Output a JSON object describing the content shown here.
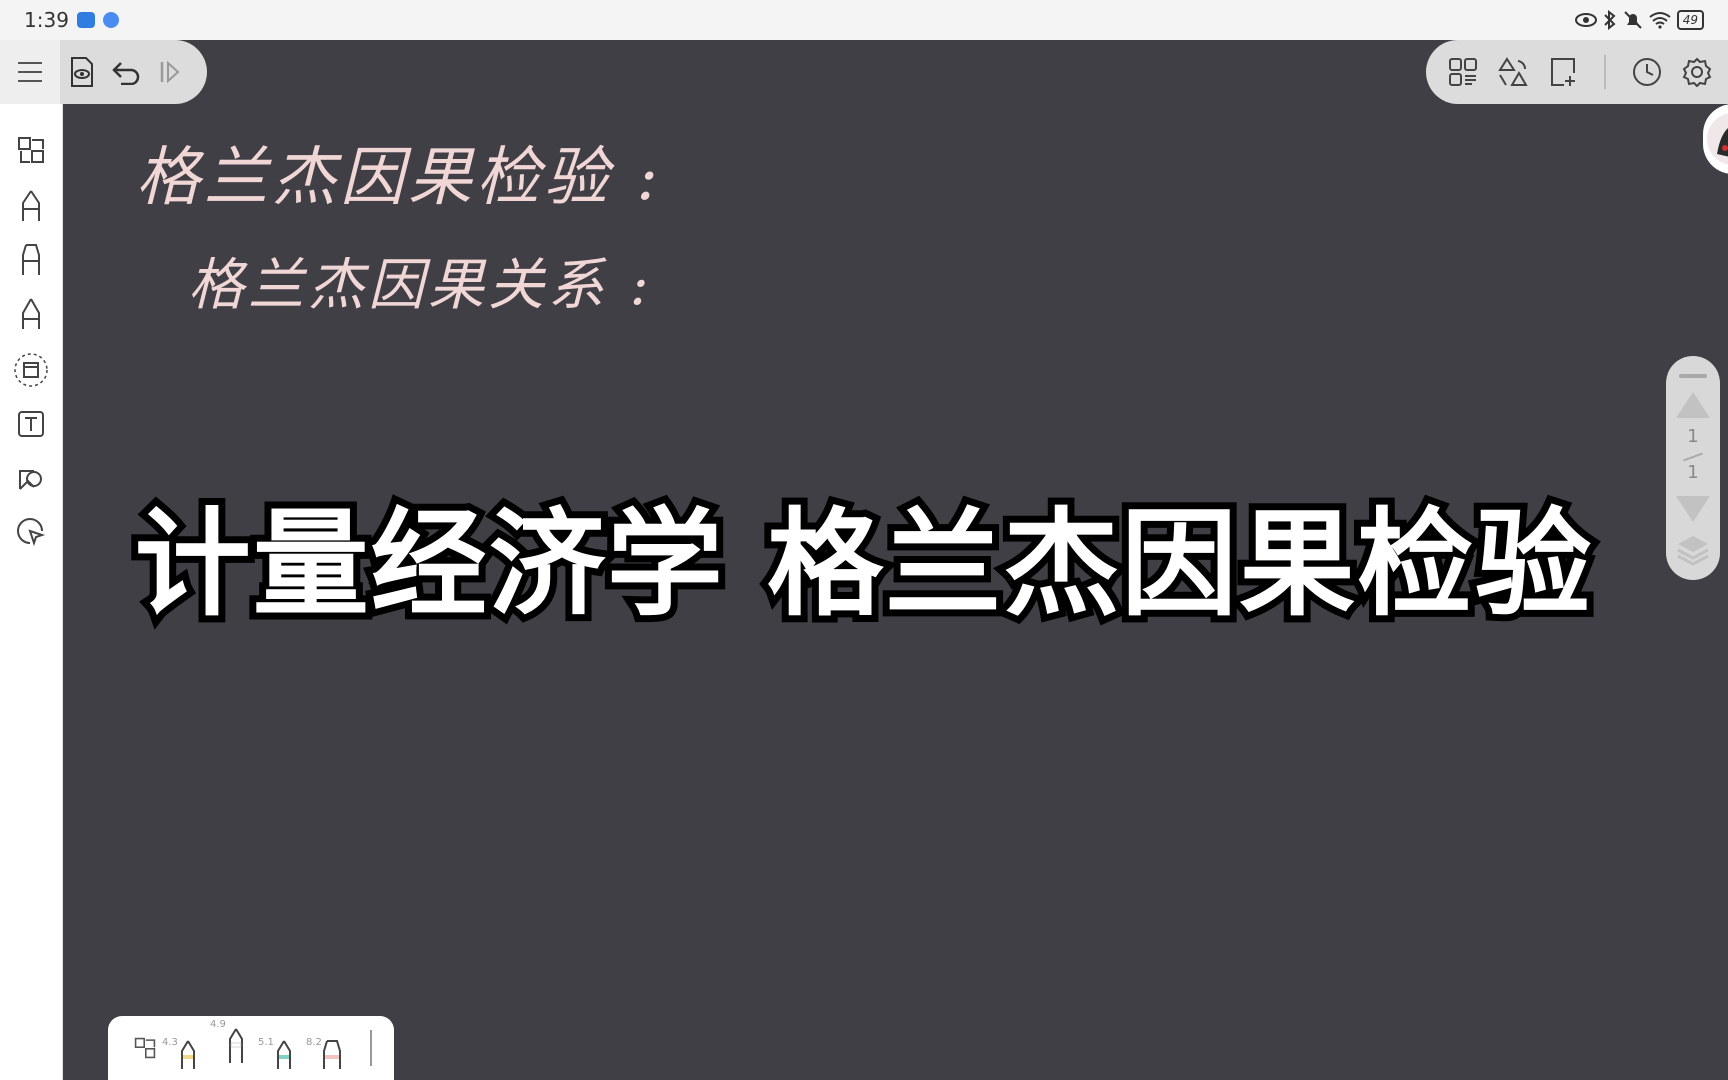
{
  "status_bar": {
    "time": "1:39",
    "battery": "49"
  },
  "handwriting": {
    "line1": "格兰杰因果检验 :",
    "line2": "格兰杰因果关系 :"
  },
  "caption": "计量经济学 格兰杰因果检验",
  "page_nav": {
    "current": "1",
    "total": "1"
  },
  "pen_tray": {
    "pens": [
      {
        "size": "4.3",
        "color": "#f2d98a"
      },
      {
        "size": "4.9",
        "color": "#ffffff"
      },
      {
        "size": "5.1",
        "color": "#7fd3c6"
      },
      {
        "size": "8.2",
        "color": "#f2c4c4"
      }
    ]
  },
  "colors": {
    "canvas": "#403f45",
    "ink": "#f1d6d6",
    "toolbar": "#dcdcdc"
  },
  "icons": {
    "left_rail": [
      "shapes-icon",
      "fountain-pen-icon",
      "marker-pen-icon",
      "pencil-icon",
      "lasso-icon",
      "text-box-icon",
      "image-icon",
      "laser-pointer-icon"
    ],
    "top_left": [
      "menu-icon",
      "read-mode-icon",
      "undo-icon",
      "redo-icon"
    ],
    "top_right": [
      "thumbnails-icon",
      "shapes-recognition-icon",
      "add-page-icon",
      "history-icon",
      "settings-icon"
    ]
  }
}
